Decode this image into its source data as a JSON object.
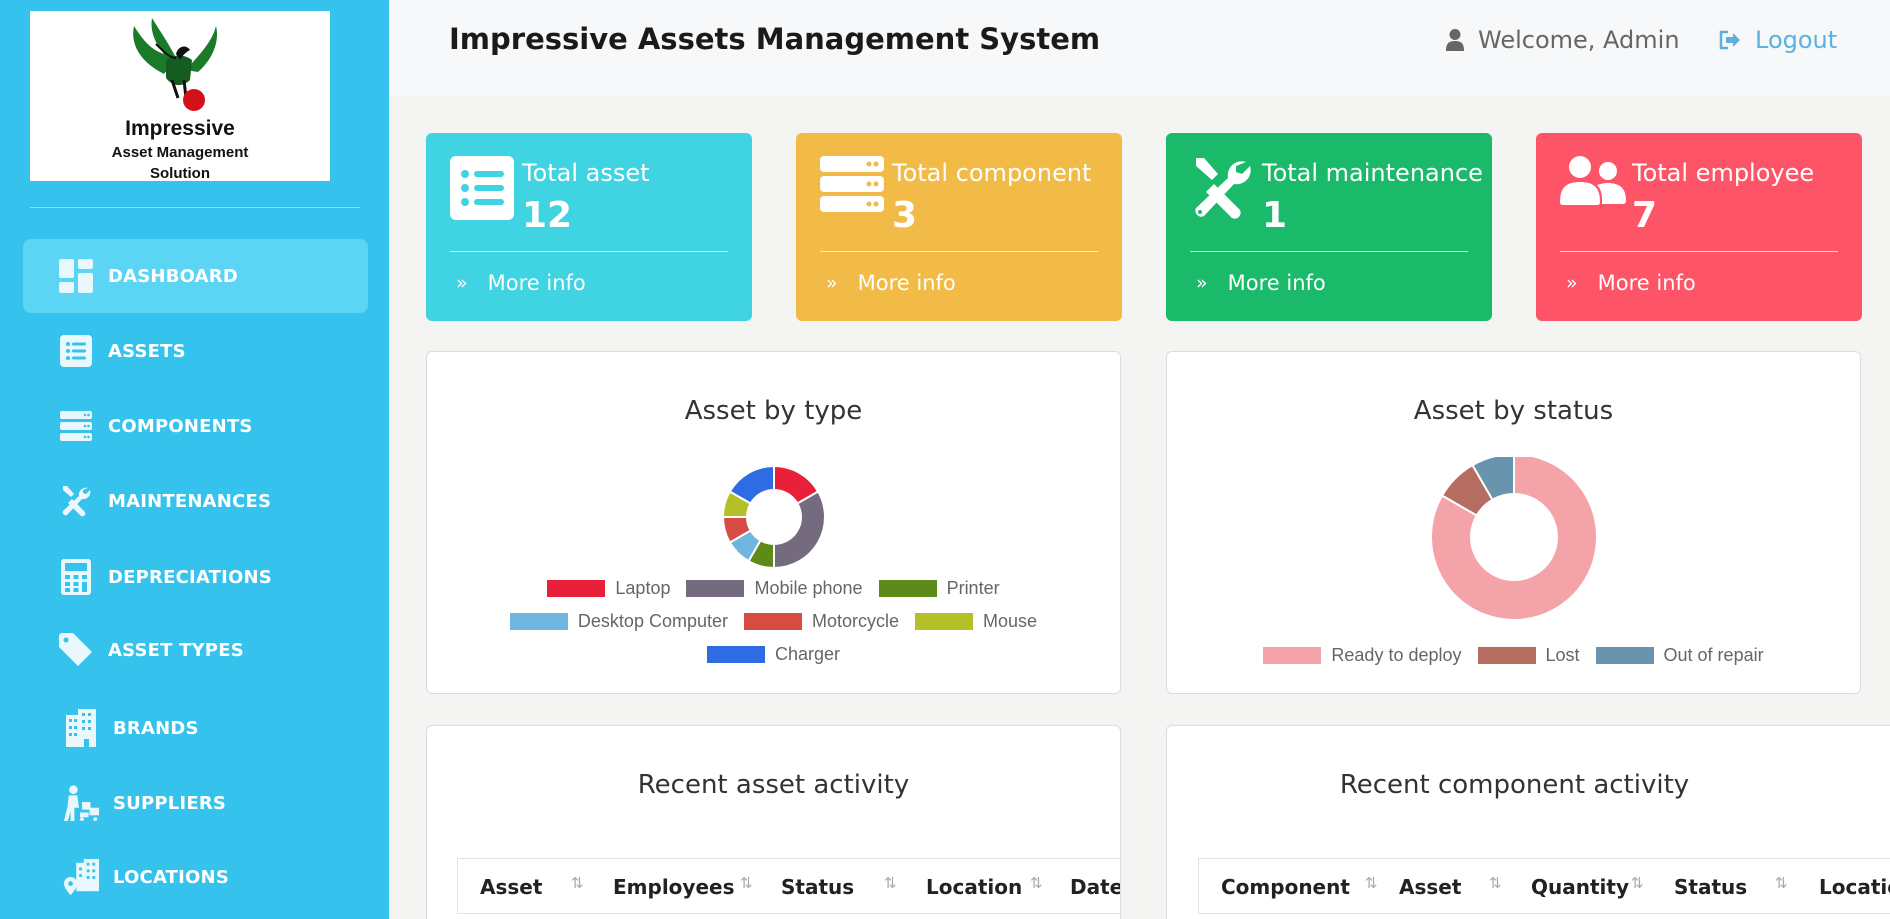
{
  "logo": {
    "title": "Impressive",
    "subtitle_line1": "Asset Management",
    "subtitle_line2": "Solution"
  },
  "sidebar": {
    "items": [
      {
        "label": "DASHBOARD",
        "icon": "dashboard-icon",
        "active": true
      },
      {
        "label": "ASSETS",
        "icon": "list-icon"
      },
      {
        "label": "COMPONENTS",
        "icon": "server-icon"
      },
      {
        "label": "MAINTENANCES",
        "icon": "tools-icon"
      },
      {
        "label": "DEPRECIATIONS",
        "icon": "calculator-icon"
      },
      {
        "label": "ASSET TYPES",
        "icon": "tag-icon"
      },
      {
        "label": "BRANDS",
        "icon": "building-icon"
      },
      {
        "label": "SUPPLIERS",
        "icon": "delivery-icon"
      },
      {
        "label": "LOCATIONS",
        "icon": "location-icon"
      }
    ]
  },
  "header": {
    "title": "Impressive Assets Management System",
    "welcome": "Welcome, Admin",
    "logout": "Logout"
  },
  "stats": [
    {
      "label": "Total asset",
      "value": "12",
      "more": "More info",
      "color": "#40d3e2",
      "icon": "list-icon"
    },
    {
      "label": "Total component",
      "value": "3",
      "more": "More info",
      "color": "#f2ba47",
      "icon": "server-icon"
    },
    {
      "label": "Total maintenance",
      "value": "1",
      "more": "More info",
      "color": "#1aba6a",
      "icon": "tools-icon"
    },
    {
      "label": "Total employee",
      "value": "7",
      "more": "More info",
      "color": "#fe5467",
      "icon": "users-icon"
    }
  ],
  "charts": {
    "by_type": {
      "title": "Asset by type"
    },
    "by_status": {
      "title": "Asset by status"
    }
  },
  "chart_data": [
    {
      "type": "pie",
      "title": "Asset by type",
      "categories": [
        "Laptop",
        "Mobile phone",
        "Printer",
        "Desktop Computer",
        "Motorcycle",
        "Mouse",
        "Charger"
      ],
      "values": [
        2,
        4,
        1,
        1,
        1,
        1,
        2
      ],
      "colors": [
        "#e8203a",
        "#756b7f",
        "#5e8a1a",
        "#6eb6df",
        "#d64b42",
        "#b5bf27",
        "#2f6be2"
      ],
      "legend": "bottom"
    },
    {
      "type": "pie",
      "title": "Asset by status",
      "categories": [
        "Ready to deploy",
        "Lost",
        "Out of repair"
      ],
      "values": [
        10,
        1,
        1
      ],
      "colors": [
        "#f4a3a8",
        "#b56d62",
        "#6994ae"
      ],
      "legend": "bottom"
    }
  ],
  "activity": {
    "asset_title": "Recent asset activity",
    "asset_columns": [
      "Asset",
      "Employees",
      "Status",
      "Location",
      "Date"
    ],
    "component_title": "Recent component activity",
    "component_columns": [
      "Component",
      "Asset",
      "Quantity",
      "Status",
      "Locatio"
    ]
  }
}
